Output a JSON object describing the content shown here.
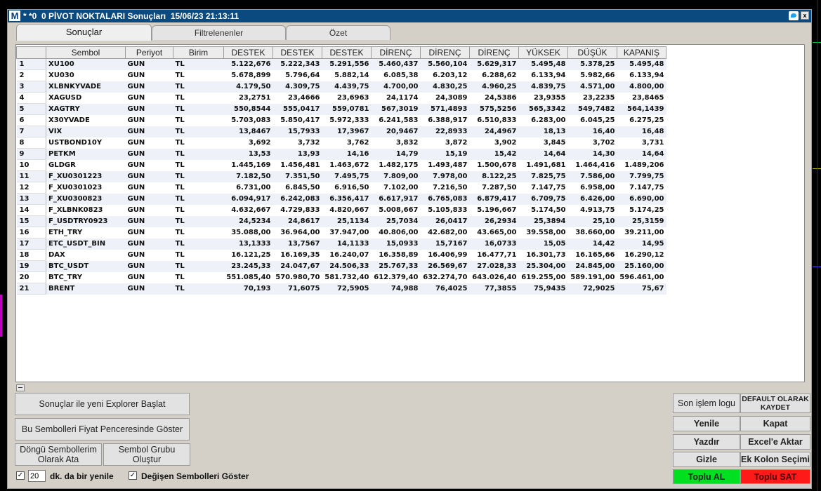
{
  "window": {
    "logo": "M",
    "title": "* *0  0 PİVOT NOKTALARI Sonuçları  15/06/23 21:13:11",
    "close_symbol": "x"
  },
  "tabs": [
    {
      "label": "Sonuçlar",
      "active": true
    },
    {
      "label": "Filtrelenenler",
      "active": false
    },
    {
      "label": "Özet",
      "active": false
    }
  ],
  "grid": {
    "columns": [
      "",
      "Sembol",
      "Periyot",
      "Birim",
      "DESTEK",
      "DESTEK",
      "DESTEK",
      "DİRENÇ",
      "DİRENÇ",
      "DİRENÇ",
      "YÜKSEK",
      "DÜŞÜK",
      "KAPANIŞ"
    ],
    "rows": [
      [
        "1",
        "XU100",
        "GUN",
        "TL",
        "5.122,676",
        "5.222,343",
        "5.291,556",
        "5.460,437",
        "5.560,104",
        "5.629,317",
        "5.495,48",
        "5.378,25",
        "5.495,48"
      ],
      [
        "2",
        "XU030",
        "GUN",
        "TL",
        "5.678,899",
        "5.796,64",
        "5.882,14",
        "6.085,38",
        "6.203,12",
        "6.288,62",
        "6.133,94",
        "5.982,66",
        "6.133,94"
      ],
      [
        "3",
        "XLBNKYVADE",
        "GUN",
        "TL",
        "4.179,50",
        "4.309,75",
        "4.439,75",
        "4.700,00",
        "4.830,25",
        "4.960,25",
        "4.839,75",
        "4.571,00",
        "4.800,00"
      ],
      [
        "4",
        "XAGUSD",
        "GUN",
        "TL",
        "23,2751",
        "23,4666",
        "23,6963",
        "24,1174",
        "24,3089",
        "24,5386",
        "23,9355",
        "23,2235",
        "23,8465"
      ],
      [
        "5",
        "XAGTRY",
        "GUN",
        "TL",
        "550,8544",
        "555,0417",
        "559,0781",
        "567,3019",
        "571,4893",
        "575,5256",
        "565,3342",
        "549,7482",
        "564,1439"
      ],
      [
        "6",
        "X30YVADE",
        "GUN",
        "TL",
        "5.703,083",
        "5.850,417",
        "5.972,333",
        "6.241,583",
        "6.388,917",
        "6.510,833",
        "6.283,00",
        "6.045,25",
        "6.275,25"
      ],
      [
        "7",
        "VIX",
        "GUN",
        "TL",
        "13,8467",
        "15,7933",
        "17,3967",
        "20,9467",
        "22,8933",
        "24,4967",
        "18,13",
        "16,40",
        "16,48"
      ],
      [
        "8",
        "USTBOND10Y",
        "GUN",
        "TL",
        "3,692",
        "3,732",
        "3,762",
        "3,832",
        "3,872",
        "3,902",
        "3,845",
        "3,702",
        "3,731"
      ],
      [
        "9",
        "PETKM",
        "GUN",
        "TL",
        "13,53",
        "13,93",
        "14,16",
        "14,79",
        "15,19",
        "15,42",
        "14,64",
        "14,30",
        "14,64"
      ],
      [
        "10",
        "GLDGR",
        "GUN",
        "TL",
        "1.445,169",
        "1.456,481",
        "1.463,672",
        "1.482,175",
        "1.493,487",
        "1.500,678",
        "1.491,681",
        "1.464,416",
        "1.489,206"
      ],
      [
        "11",
        "F_XU0301223",
        "GUN",
        "TL",
        "7.182,50",
        "7.351,50",
        "7.495,75",
        "7.809,00",
        "7.978,00",
        "8.122,25",
        "7.825,75",
        "7.586,00",
        "7.799,75"
      ],
      [
        "12",
        "F_XU0301023",
        "GUN",
        "TL",
        "6.731,00",
        "6.845,50",
        "6.916,50",
        "7.102,00",
        "7.216,50",
        "7.287,50",
        "7.147,75",
        "6.958,00",
        "7.147,75"
      ],
      [
        "13",
        "F_XU0300823",
        "GUN",
        "TL",
        "6.094,917",
        "6.242,083",
        "6.356,417",
        "6.617,917",
        "6.765,083",
        "6.879,417",
        "6.709,75",
        "6.426,00",
        "6.690,00"
      ],
      [
        "14",
        "F_XLBNK0823",
        "GUN",
        "TL",
        "4.632,667",
        "4.729,833",
        "4.820,667",
        "5.008,667",
        "5.105,833",
        "5.196,667",
        "5.174,50",
        "4.913,75",
        "5.174,25"
      ],
      [
        "15",
        "F_USDTRY0923",
        "GUN",
        "TL",
        "24,5234",
        "24,8617",
        "25,1134",
        "25,7034",
        "26,0417",
        "26,2934",
        "25,3894",
        "25,10",
        "25,3159"
      ],
      [
        "16",
        "ETH_TRY",
        "GUN",
        "TL",
        "35.088,00",
        "36.964,00",
        "37.947,00",
        "40.806,00",
        "42.682,00",
        "43.665,00",
        "39.558,00",
        "38.660,00",
        "39.211,00"
      ],
      [
        "17",
        "ETC_USDT_BIN",
        "GUN",
        "TL",
        "13,1333",
        "13,7567",
        "14,1133",
        "15,0933",
        "15,7167",
        "16,0733",
        "15,05",
        "14,42",
        "14,95"
      ],
      [
        "18",
        "DAX",
        "GUN",
        "TL",
        "16.121,25",
        "16.169,35",
        "16.240,07",
        "16.358,89",
        "16.406,99",
        "16.477,71",
        "16.301,73",
        "16.165,66",
        "16.290,12"
      ],
      [
        "19",
        "BTC_USDT",
        "GUN",
        "TL",
        "23.245,33",
        "24.047,67",
        "24.506,33",
        "25.767,33",
        "26.569,67",
        "27.028,33",
        "25.304,00",
        "24.845,00",
        "25.160,00"
      ],
      [
        "20",
        "BTC_TRY",
        "GUN",
        "TL",
        "551.085,40",
        "570.980,70",
        "581.732,40",
        "612.379,40",
        "632.274,70",
        "643.026,40",
        "619.255,00",
        "589.191,00",
        "596.461,00"
      ],
      [
        "21",
        "BRENT",
        "GUN",
        "TL",
        "70,193",
        "71,6075",
        "72,5905",
        "74,988",
        "76,4025",
        "77,3855",
        "75,9435",
        "72,9025",
        "75,67"
      ]
    ]
  },
  "left_buttons": {
    "explorer": "Sonuçlar ile yeni Explorer Başlat",
    "price_window": "Bu Sembolleri Fiyat Penceresinde Göster",
    "loop_symbols": "Döngü Sembollerim Olarak Ata",
    "symbol_group": "Sembol Grubu Oluştur"
  },
  "bottom_controls": {
    "refresh_interval_value": "20",
    "refresh_label": "dk. da bir yenile",
    "changed_symbols_label": "Değişen Sembolleri Göster",
    "check_mark": "✓"
  },
  "right_buttons": {
    "last_trade_log": "Son işlem logu",
    "save_default": "DEFAULT OLARAK KAYDET",
    "refresh": "Yenile",
    "close": "Kapat",
    "print": "Yazdır",
    "excel": "Excel'e Aktar",
    "hide": "Gizle",
    "extra_column": "Ek Kolon Seçimi",
    "bulk_buy": "Toplu AL",
    "bulk_sell": "Toplu SAT"
  },
  "colors": {
    "title_bar": "#0a4a7f",
    "row_alt": "#eef1f8",
    "buy": "#00e020",
    "sell": "#ff1a1a"
  }
}
